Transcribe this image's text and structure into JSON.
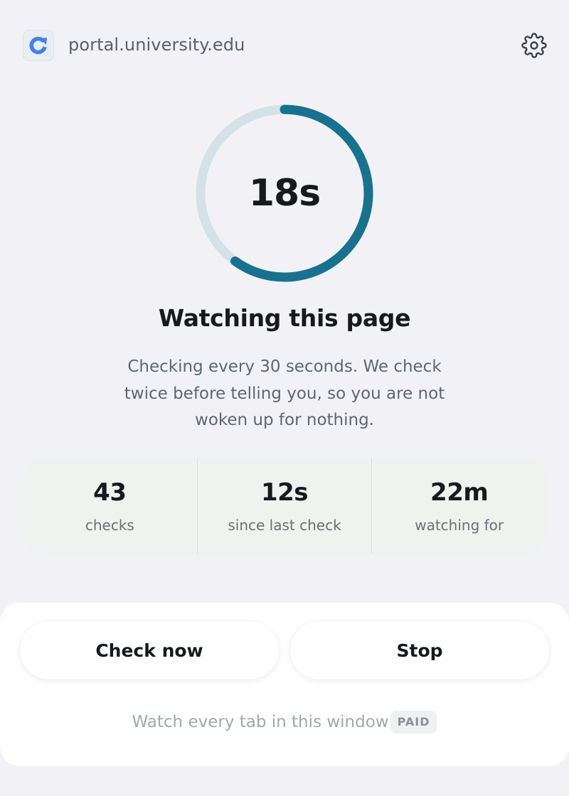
{
  "header": {
    "domain": "portal.university.edu",
    "favicon_icon": "refresh-arrow-icon",
    "settings_icon": "gear-icon"
  },
  "timer": {
    "countdown": "18s",
    "remaining_fraction": 0.6,
    "track_color": "#d3e2e7",
    "progress_color": "#16728f"
  },
  "status": {
    "title": "Watching this page",
    "description": "Checking every 30 seconds. We check twice before telling you, so you are not woken up for nothing."
  },
  "stats": [
    {
      "value": "43",
      "label": "checks"
    },
    {
      "value": "12s",
      "label": "since last check"
    },
    {
      "value": "22m",
      "label": "watching for"
    }
  ],
  "actions": {
    "check_now": "Check now",
    "stop": "Stop"
  },
  "upsell": {
    "text": "Watch every tab in this window",
    "badge": "PAID"
  },
  "colors": {
    "accent": "#16728f",
    "favicon_blue": "#3b82f6",
    "background": "#f2f2f6"
  }
}
